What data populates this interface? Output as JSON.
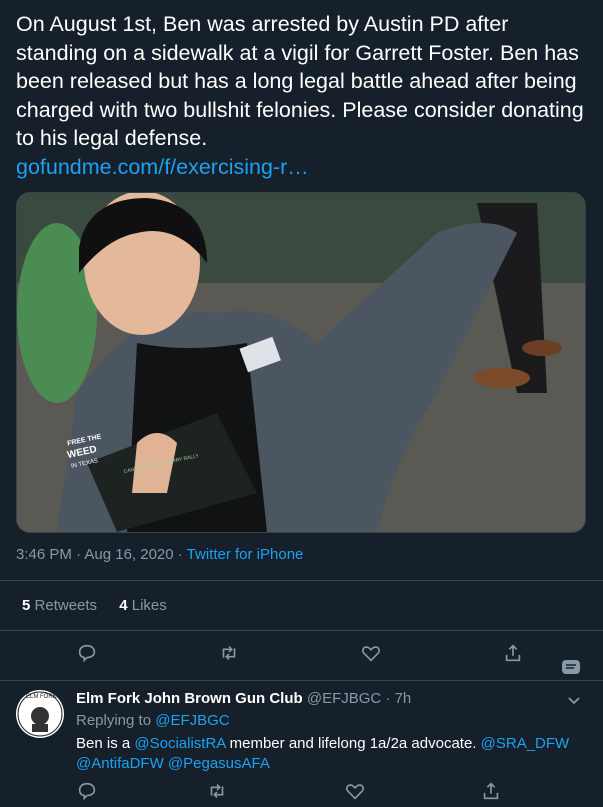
{
  "tweet": {
    "text": "On August 1st, Ben was arrested by Austin PD after standing on a sidewalk at a vigil for Garrett Foster. Ben has been released but has a long legal battle ahead after being charged with two bullshit felonies. Please consider donating to his legal defense.",
    "link": "gofundme.com/f/exercising-r…",
    "time": "3:46 PM · Aug 16, 2020 · ",
    "source": "Twitter for iPhone",
    "retweets_count": "5",
    "retweets_label": "Retweets",
    "likes_count": "4",
    "likes_label": "Likes",
    "photo_text": {
      "line1": "FREE THE",
      "line2": "WEED",
      "line3": "IN TEXAS",
      "card_title": "CANNABIS OPEN CARRY RALLY"
    }
  },
  "reply": {
    "name": "Elm Fork John Brown Gun Club",
    "handle": "@EFJBGC · 7h",
    "replying_prefix": "Replying to ",
    "replying_to": "@EFJBGC",
    "body_part1": "Ben is a ",
    "mention1": "@SocialistRA",
    "body_part2": " member and lifelong 1a/2a advocate. ",
    "mention2": "@SRA_DFW",
    "mention3": "@AntifaDFW",
    "mention4": "@PegasusAFA",
    "avatar_text": "ELM FORK"
  },
  "icons": [
    "reply-icon",
    "retweet-icon",
    "like-icon",
    "share-icon",
    "chevron-down-icon"
  ],
  "colors": {
    "background": "#15202b",
    "accent": "#1da1f2",
    "muted": "#8899a6",
    "divider": "#38444d"
  }
}
